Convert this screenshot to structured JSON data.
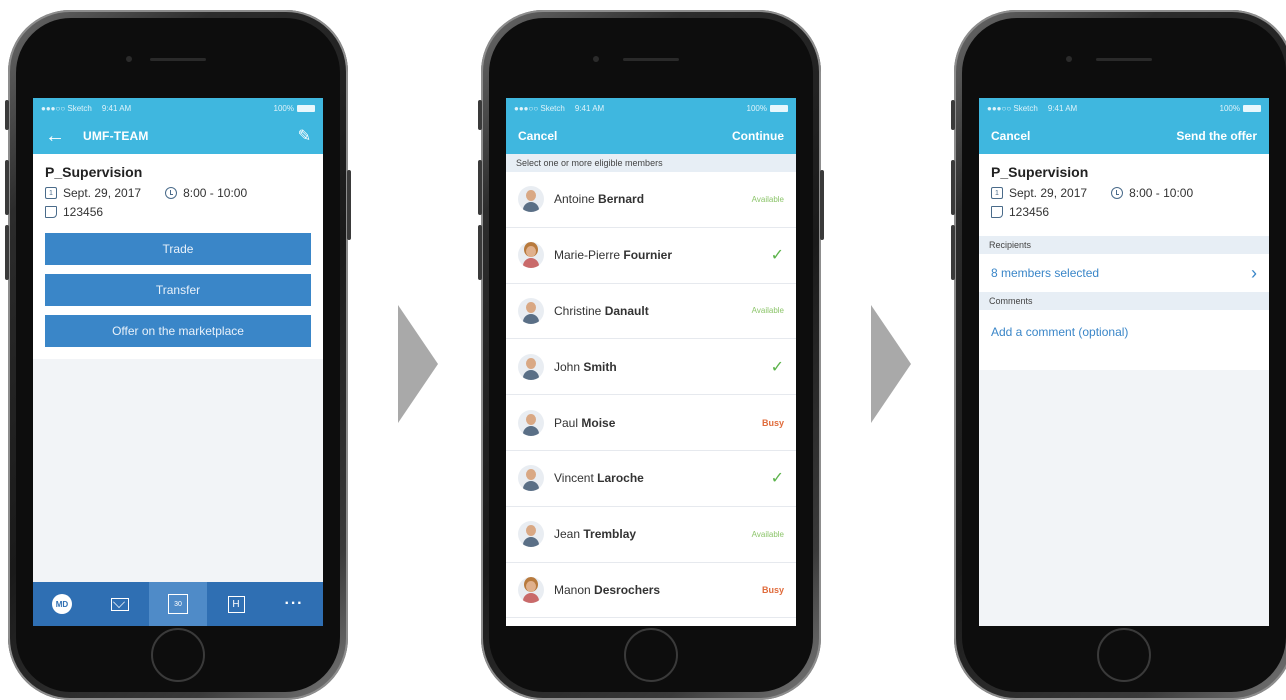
{
  "status_bar": {
    "carrier": "●●●○○ Sketch",
    "time": "9:41 AM",
    "battery": "100%"
  },
  "screen1": {
    "nav_title": "UMF-TEAM",
    "shift": {
      "title": "P_Supervision",
      "date": "Sept. 29, 2017",
      "time": "8:00 - 10:00",
      "id": "123456",
      "date_icon_label": "1"
    },
    "actions": [
      "Trade",
      "Transfer",
      "Offer on the marketplace"
    ],
    "tabbar": {
      "md_label": "MD",
      "calendar_label": "30",
      "h_label": "H",
      "more_label": "···"
    }
  },
  "screen2": {
    "cancel_label": "Cancel",
    "continue_label": "Continue",
    "section_label": "Select one or more eligible members",
    "members": [
      {
        "first": "Antoine",
        "last": "Bernard",
        "status": "Available",
        "kind": "available"
      },
      {
        "first": "Marie-Pierre",
        "last": "Fournier",
        "status": "✓",
        "kind": "check"
      },
      {
        "first": "Christine",
        "last": "Danault",
        "status": "Available",
        "kind": "available"
      },
      {
        "first": "John",
        "last": "Smith",
        "status": "✓",
        "kind": "check"
      },
      {
        "first": "Paul",
        "last": "Moise",
        "status": "Busy",
        "kind": "busy"
      },
      {
        "first": "Vincent",
        "last": "Laroche",
        "status": "✓",
        "kind": "check"
      },
      {
        "first": "Jean",
        "last": "Tremblay",
        "status": "Available",
        "kind": "available"
      },
      {
        "first": "Manon",
        "last": "Desrochers",
        "status": "Busy",
        "kind": "busy"
      }
    ]
  },
  "screen3": {
    "cancel_label": "Cancel",
    "send_label": "Send the offer",
    "shift": {
      "title": "P_Supervision",
      "date": "Sept. 29, 2017",
      "time": "8:00 - 10:00",
      "id": "123456",
      "date_icon_label": "1"
    },
    "recipients_header": "Recipients",
    "recipients_value": "8 members selected",
    "comments_header": "Comments",
    "comment_placeholder": "Add a comment (optional)"
  },
  "colors": {
    "header": "#3fb7df",
    "button": "#3a86c8",
    "tabbar": "#2f6fb3",
    "available": "#8cc56a",
    "busy": "#e06b3b",
    "check": "#5bb34a"
  }
}
